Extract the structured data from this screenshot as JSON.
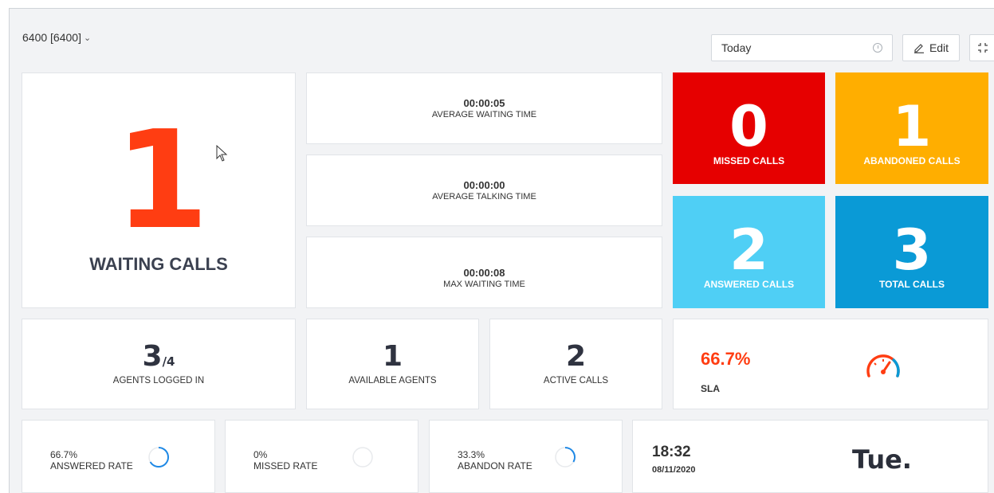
{
  "header": {
    "queue_label": "6400 [6400]",
    "date_range": "Today",
    "edit_label": "Edit"
  },
  "waiting": {
    "value": "1",
    "label": "WAITING CALLS"
  },
  "times": [
    {
      "value": "00:00:05",
      "label": "AVERAGE WAITING TIME"
    },
    {
      "value": "00:00:00",
      "label": "AVERAGE TALKING TIME"
    },
    {
      "value": "00:00:08",
      "label": "MAX WAITING TIME"
    }
  ],
  "tiles": [
    {
      "value": "0",
      "label": "MISSED CALLS",
      "color": "#e60000"
    },
    {
      "value": "1",
      "label": "ABANDONED CALLS",
      "color": "#ffae00"
    },
    {
      "value": "2",
      "label": "ANSWERED CALLS",
      "color": "#4fcff5"
    },
    {
      "value": "3",
      "label": "TOTAL CALLS",
      "color": "#0a9ad6"
    }
  ],
  "agents_logged_in": {
    "value": "3",
    "total": "/4",
    "label": "AGENTS LOGGED IN"
  },
  "available_agents": {
    "value": "1",
    "label": "AVAILABLE AGENTS"
  },
  "active_calls": {
    "value": "2",
    "label": "ACTIVE CALLS"
  },
  "sla": {
    "value": "66.7%",
    "label": "SLA"
  },
  "rates": [
    {
      "value": "66.7%",
      "label": "ANSWERED RATE",
      "fraction": 0.667
    },
    {
      "value": "0%",
      "label": "MISSED RATE",
      "fraction": 0.0
    },
    {
      "value": "33.3%",
      "label": "ABANDON RATE",
      "fraction": 0.333
    }
  ],
  "clock": {
    "time": "18:32",
    "date": "08/11/2020",
    "day": "Tue."
  }
}
